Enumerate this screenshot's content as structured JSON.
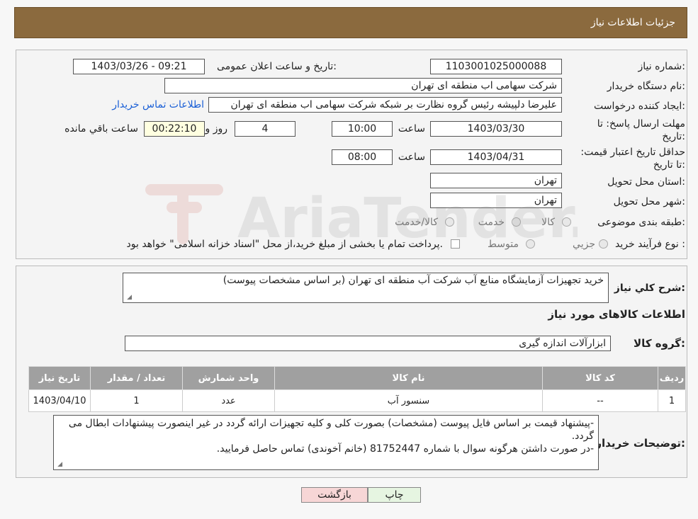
{
  "header": {
    "title": "جزئیات اطلاعات نیاز"
  },
  "form": {
    "need_number_label": "شماره نیاز:",
    "need_number": "1103001025000088",
    "announce_label": "تاریخ و ساعت اعلان عمومی:",
    "announce_value": "1403/03/26 - 09:21",
    "buyer_label": "نام دستگاه خریدار:",
    "buyer_value": "شرکت سهامی اب منطقه ای تهران",
    "creator_label": "ایجاد کننده درخواست:",
    "creator_value": "علیرضا دلپیشه رئیس گروه نظارت بر شبکه شرکت سهامی اب منطقه ای تهران",
    "contact_link": "اطلاعات تماس خریدار",
    "deadline_label": "مهلت ارسال پاسخ: تا تاریخ:",
    "deadline_date": "1403/03/30",
    "time_label": "ساعت",
    "deadline_time": "10:00",
    "days_value": "4",
    "days_label": "روز و",
    "remaining_value": "00:22:10",
    "remaining_label": "ساعت باقي مانده",
    "validity_label": "حداقل تاریخ اعتبار قیمت: تا تاریخ:",
    "validity_date": "1403/04/31",
    "validity_time": "08:00",
    "province_label": "استان محل تحویل:",
    "province_value": "تهران",
    "city_label": "شهر محل تحویل:",
    "city_value": "تهران",
    "category_label": "طبقه بندی موضوعی:",
    "category_options": [
      "کالا",
      "خدمت",
      "کالا/خدمت"
    ],
    "process_label": "نوع فرآیند خرید :",
    "process_options": [
      "جزیي",
      "متوسط"
    ],
    "payment_note": "پرداخت تمام یا بخشی از مبلغ خرید،از محل \"اسناد خزانه اسلامی\" خواهد بود."
  },
  "details": {
    "summary_label": "شرح کلي نیاز:",
    "summary_value": "خرید تجهیزات آزمایشگاه منابع آب شرکت آب منطقه ای تهران (بر اساس مشخصات پیوست)",
    "goods_section_title": "اطلاعات کالاهای مورد نیاز",
    "goods_group_label": "گروه کالا:",
    "goods_group_value": "ابزارآلات اندازه گیری",
    "table": {
      "headers": [
        "ردیف",
        "کد کالا",
        "نام کالا",
        "واحد شمارش",
        "تعداد / مقدار",
        "تاریخ نیاز"
      ],
      "rows": [
        [
          "1",
          "--",
          "سنسور آب",
          "عدد",
          "1",
          "1403/04/10"
        ]
      ]
    },
    "buyer_notes_label": "توضیحات خریدار:",
    "buyer_notes_line1": "-پیشنهاد قیمت بر اساس فایل پیوست (مشخصات) بصورت کلی و کلیه تجهیزات ارائه گردد در غیر اینصورت پیشنهادات ابطال می گردد.",
    "buyer_notes_line2": "-در صورت داشتن هرگونه سوال با شماره 81752447 (خانم آخوندی) تماس حاصل فرمایید."
  },
  "buttons": {
    "print": "چاپ",
    "back": "بازگشت"
  },
  "watermark": {
    "text": "AriaTender.neT"
  },
  "colors": {
    "header_bg": "#8b6a3e",
    "link": "#1a5fd6",
    "table_header": "#a0a0a0",
    "back_btn": "#f7d6d6",
    "print_btn": "#e6f5e1"
  }
}
